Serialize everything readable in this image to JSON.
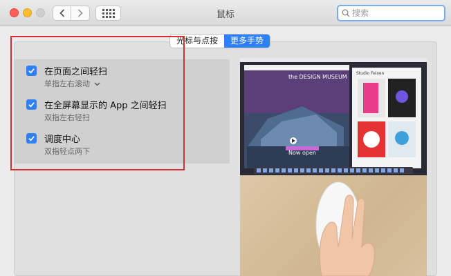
{
  "window": {
    "title": "鼠标"
  },
  "toolbar": {
    "back_icon": "chevron-left-icon",
    "forward_icon": "chevron-right-icon",
    "grid_icon": "show-all-grid-icon"
  },
  "search": {
    "placeholder": "搜索",
    "value": ""
  },
  "tabs": [
    {
      "label": "光标与点按",
      "active": false
    },
    {
      "label": "更多手势",
      "active": true
    }
  ],
  "gestures": [
    {
      "label": "在页面之间轻扫",
      "sub": "单指左右滚动",
      "has_dropdown": true,
      "checked": true
    },
    {
      "label": "在全屏幕显示的 App 之间轻扫",
      "sub": "双指左右轻扫",
      "has_dropdown": false,
      "checked": true
    },
    {
      "label": "调度中心",
      "sub": "双指轻点两下",
      "has_dropdown": false,
      "checked": true
    }
  ],
  "preview": {
    "museum_title": "the DESIGN MUSEUM",
    "card_title": "Studio Feixen",
    "now_open": "Now open"
  },
  "colors": {
    "accent": "#2f7ff7",
    "highlight": "#d92c2c",
    "traffic_red": "#fd5f57",
    "traffic_yellow": "#febc2e"
  }
}
